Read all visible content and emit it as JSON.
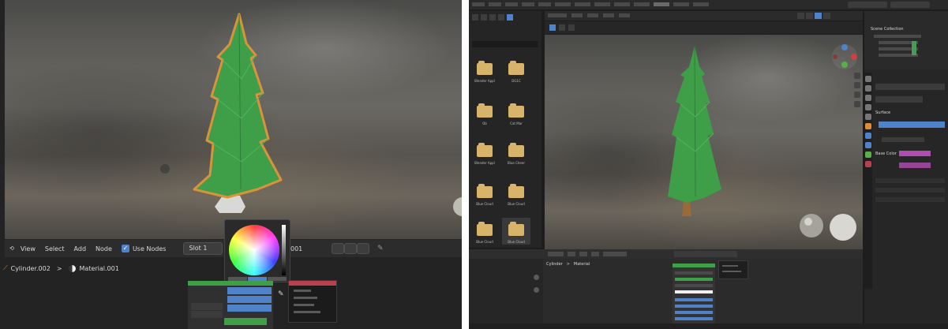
{
  "left": {
    "header_menu": [
      "View",
      "Select",
      "Add",
      "Node"
    ],
    "use_nodes_label": "Use Nodes",
    "slot_label": "Slot 1",
    "material_suffix": "001",
    "breadcrumb": {
      "object": "Cylinder.002",
      "material": "Material.001"
    }
  },
  "right": {
    "sidebar_folders": [
      "Blender Appl",
      "DG1C",
      "Ob",
      "Cat Mar",
      "Blender Appl",
      "Blue Cheer",
      "Blue Cloud",
      "Blue Cloud",
      "Blue Cloud",
      "Blue Cloud"
    ],
    "breadcrumb": {
      "object": "Cylinder",
      "material": "Material"
    },
    "scene_collection_label": "Scene Collection",
    "surface_label": "Surface",
    "base_color_label": "Base Color"
  },
  "colors": {
    "tree_green": "#3f9e48",
    "tree_outline": "#d9933a",
    "selection_blue": "#4f82c9",
    "folder_yellow": "#d8b36a",
    "swatch_pink": "#b14db0"
  }
}
